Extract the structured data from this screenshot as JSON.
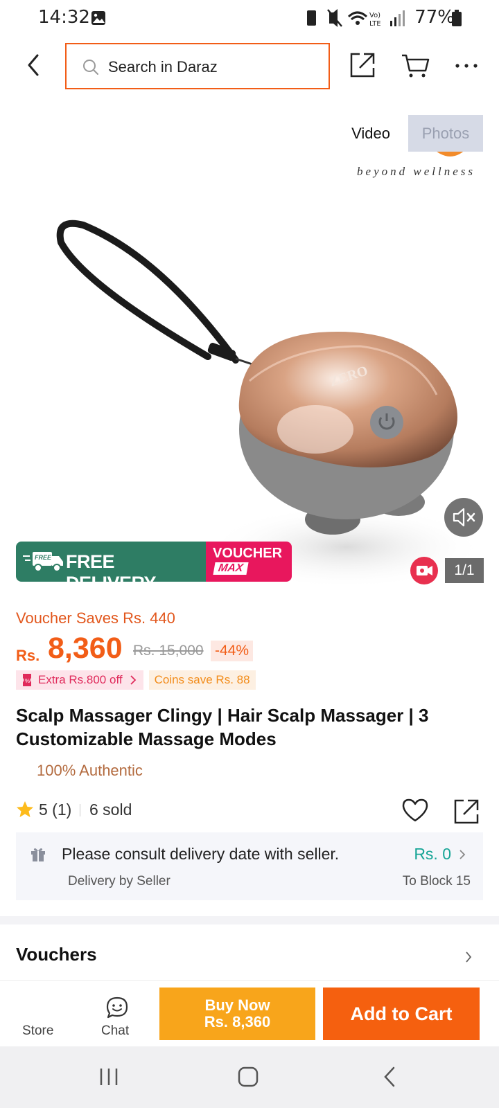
{
  "status_bar": {
    "time": "14:32",
    "battery": "77%"
  },
  "top_nav": {
    "search_placeholder": "Search in Daraz"
  },
  "media": {
    "tabs": [
      "Video",
      "Photos"
    ],
    "active_tab": "Video",
    "brand_tagline": "beyond wellness",
    "counter": "1/1",
    "promo_free_delivery": "FREE DELIVERY",
    "promo_voucher_top": "VOUCHER",
    "promo_voucher_bottom": "MAX"
  },
  "product": {
    "voucher_saves": "Voucher Saves Rs. 440",
    "currency": "Rs.",
    "price": "8,360",
    "old_price": "Rs. 15,000",
    "discount": "-44%",
    "chip_extra": "Extra Rs.800 off",
    "chip_coins": "Coins save Rs. 88",
    "title": "Scalp Massager Clingy | Hair Scalp Massager | 3 Customizable Massage Modes",
    "authentic": "100% Authentic",
    "rating": "5 (1)",
    "sold": "6 sold"
  },
  "delivery": {
    "message": "Please consult delivery date with seller.",
    "sub": "Delivery by Seller",
    "fee": "Rs. 0",
    "to": "To Block 15"
  },
  "vouchers": {
    "title": "Vouchers"
  },
  "action_bar": {
    "store_label": "Store",
    "chat_label": "Chat",
    "buy_now_line1": "Buy Now",
    "buy_now_line2": "Rs. 8,360",
    "add_to_cart": "Add to Cart"
  },
  "colors": {
    "brand_orange": "#f25d17",
    "buy_now": "#f8a51b",
    "free_delivery_green": "#2e7d64",
    "voucher_pink": "#e8175d",
    "teal_fee": "#16a596"
  },
  "icons": [
    "back-icon",
    "search-icon",
    "share-icon",
    "cart-icon",
    "more-icon",
    "mute-icon",
    "video-icon",
    "star-icon",
    "heart-icon",
    "gift-icon",
    "chevron-right-icon",
    "store-icon",
    "chat-icon"
  ]
}
